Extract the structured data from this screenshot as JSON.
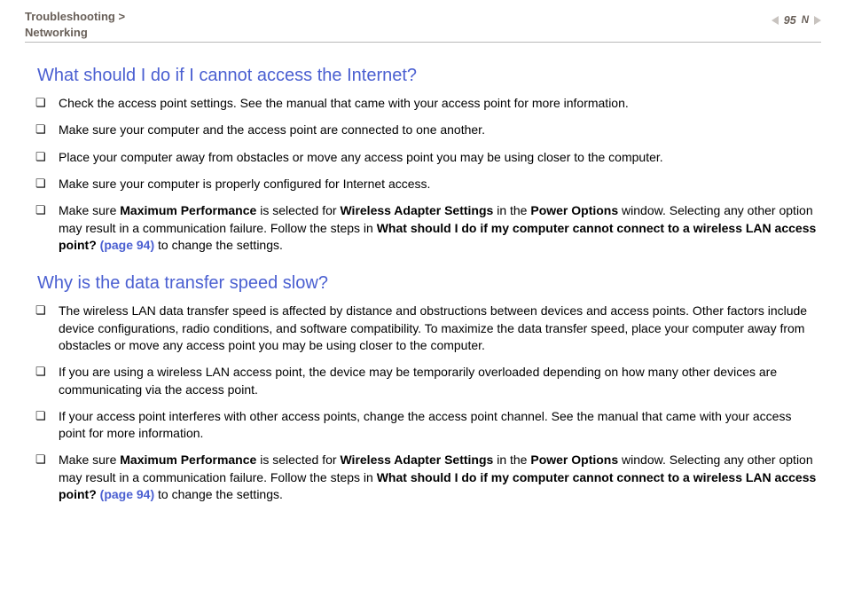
{
  "header": {
    "breadcrumb_l1": "Troubleshooting",
    "sep": ">",
    "breadcrumb_l2": "Networking",
    "page_number": "95",
    "n_label": "N"
  },
  "sections": [
    {
      "heading": "What should I do if I cannot access the Internet?",
      "items": [
        {
          "segs": [
            {
              "t": "Check the access point settings. See the manual that came with your access point for more information."
            }
          ]
        },
        {
          "segs": [
            {
              "t": "Make sure your computer and the access point are connected to one another."
            }
          ]
        },
        {
          "segs": [
            {
              "t": "Place your computer away from obstacles or move any access point you may be using closer to the computer."
            }
          ]
        },
        {
          "segs": [
            {
              "t": "Make sure your computer is properly configured for Internet access."
            }
          ]
        },
        {
          "segs": [
            {
              "t": "Make sure "
            },
            {
              "t": "Maximum Performance",
              "b": true
            },
            {
              "t": " is selected for "
            },
            {
              "t": "Wireless Adapter Settings",
              "b": true
            },
            {
              "t": " in the "
            },
            {
              "t": "Power Options",
              "b": true
            },
            {
              "t": " window. Selecting any other option may result in a communication failure. Follow the steps in "
            },
            {
              "t": "What should I do if my computer cannot connect to a wireless LAN access point? ",
              "b": true
            },
            {
              "t": "(page 94)",
              "lk": true
            },
            {
              "t": " to change the settings."
            }
          ]
        }
      ]
    },
    {
      "heading": "Why is the data transfer speed slow?",
      "items": [
        {
          "segs": [
            {
              "t": "The wireless LAN data transfer speed is affected by distance and obstructions between devices and access points. Other factors include device configurations, radio conditions, and software compatibility. To maximize the data transfer speed, place your computer away from obstacles or move any access point you may be using closer to the computer."
            }
          ]
        },
        {
          "segs": [
            {
              "t": "If you are using a wireless LAN access point, the device may be temporarily overloaded depending on how many other devices are communicating via the access point."
            }
          ]
        },
        {
          "segs": [
            {
              "t": "If your access point interferes with other access points, change the access point channel. See the manual that came with your access point for more information."
            }
          ]
        },
        {
          "segs": [
            {
              "t": "Make sure "
            },
            {
              "t": "Maximum Performance",
              "b": true
            },
            {
              "t": " is selected for "
            },
            {
              "t": "Wireless Adapter Settings",
              "b": true
            },
            {
              "t": " in the "
            },
            {
              "t": "Power Options",
              "b": true
            },
            {
              "t": " window. Selecting any other option may result in a communication failure. Follow the steps in "
            },
            {
              "t": "What should I do if my computer cannot connect to a wireless LAN access point? ",
              "b": true
            },
            {
              "t": "(page 94)",
              "lk": true
            },
            {
              "t": " to change the settings."
            }
          ]
        }
      ]
    }
  ]
}
